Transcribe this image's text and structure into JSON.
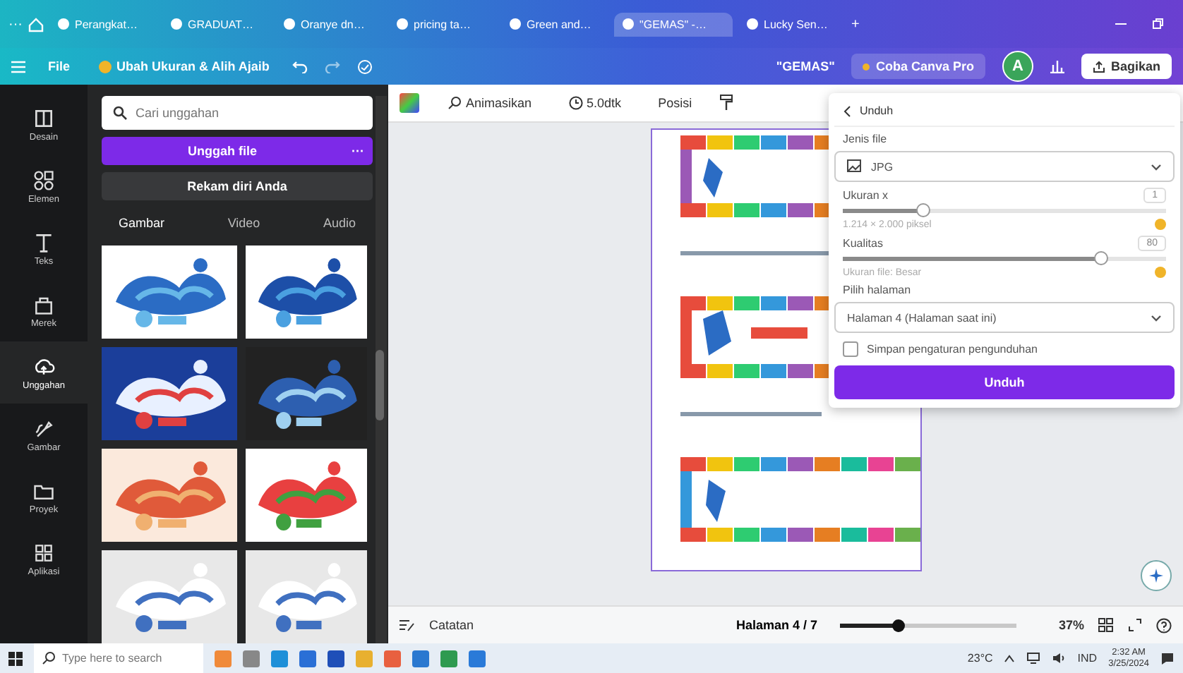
{
  "browser": {
    "menu": "···",
    "tabs": [
      {
        "label": "Perangkat…",
        "selected": false
      },
      {
        "label": "GRADUAT…",
        "selected": false
      },
      {
        "label": "Oranye dn…",
        "selected": false
      },
      {
        "label": "pricing ta…",
        "selected": false
      },
      {
        "label": "Green and…",
        "selected": false
      },
      {
        "label": "\"GEMAS\" -…",
        "selected": true
      },
      {
        "label": "Lucky Sen…",
        "selected": false
      }
    ],
    "new_tab": "+"
  },
  "header": {
    "menu": "File",
    "resize": "Ubah Ukuran & Alih Ajaib",
    "title": "\"GEMAS\"",
    "pro": "Coba Canva Pro",
    "avatar": "A",
    "share": "Bagikan"
  },
  "sidebar": {
    "items": [
      {
        "label": "Desain",
        "selected": false
      },
      {
        "label": "Elemen",
        "selected": false
      },
      {
        "label": "Teks",
        "selected": false
      },
      {
        "label": "Merek",
        "selected": false
      },
      {
        "label": "Unggahan",
        "selected": true
      },
      {
        "label": "Gambar",
        "selected": false
      },
      {
        "label": "Proyek",
        "selected": false
      },
      {
        "label": "Aplikasi",
        "selected": false
      }
    ]
  },
  "panel": {
    "search": {
      "placeholder": "Cari unggahan"
    },
    "upload": "Unggah file",
    "more": "···",
    "record": "Rekam diri Anda",
    "tabs": [
      {
        "label": "Gambar",
        "selected": true
      },
      {
        "label": "Video",
        "selected": false
      },
      {
        "label": "Audio",
        "selected": false
      }
    ]
  },
  "toolbar": {
    "animate": "Animasikan",
    "duration": "5.0dtk",
    "position": "Posisi"
  },
  "download": {
    "title": "Unduh",
    "file_type_label": "Jenis file",
    "file_type": "JPG",
    "size_label": "Ukuran x",
    "size_value": "1",
    "size_slider": {
      "level": 0.25
    },
    "size_note": "1.214 × 2.000 piksel",
    "quality_label": "Kualitas",
    "quality_value": "80",
    "quality_slider": {
      "level": 0.8
    },
    "quality_note": "Ukuran file: Besar",
    "pages_label": "Pilih halaman",
    "pages": "Halaman 4 (Halaman saat ini)",
    "remember": {
      "label": "Simpan pengaturan pengunduhan",
      "checked": false
    },
    "button": "Unduh"
  },
  "bottom_bar": {
    "notes": "Catatan",
    "page": "Halaman 4 / 7",
    "zoom": {
      "level": 0.33
    },
    "zoom_reading": "37%"
  },
  "taskbar": {
    "search": {
      "placeholder": "Type here to search"
    },
    "temperature": "23°C",
    "language": "IND",
    "time": "2:32 AM",
    "date": "3/25/2024"
  }
}
